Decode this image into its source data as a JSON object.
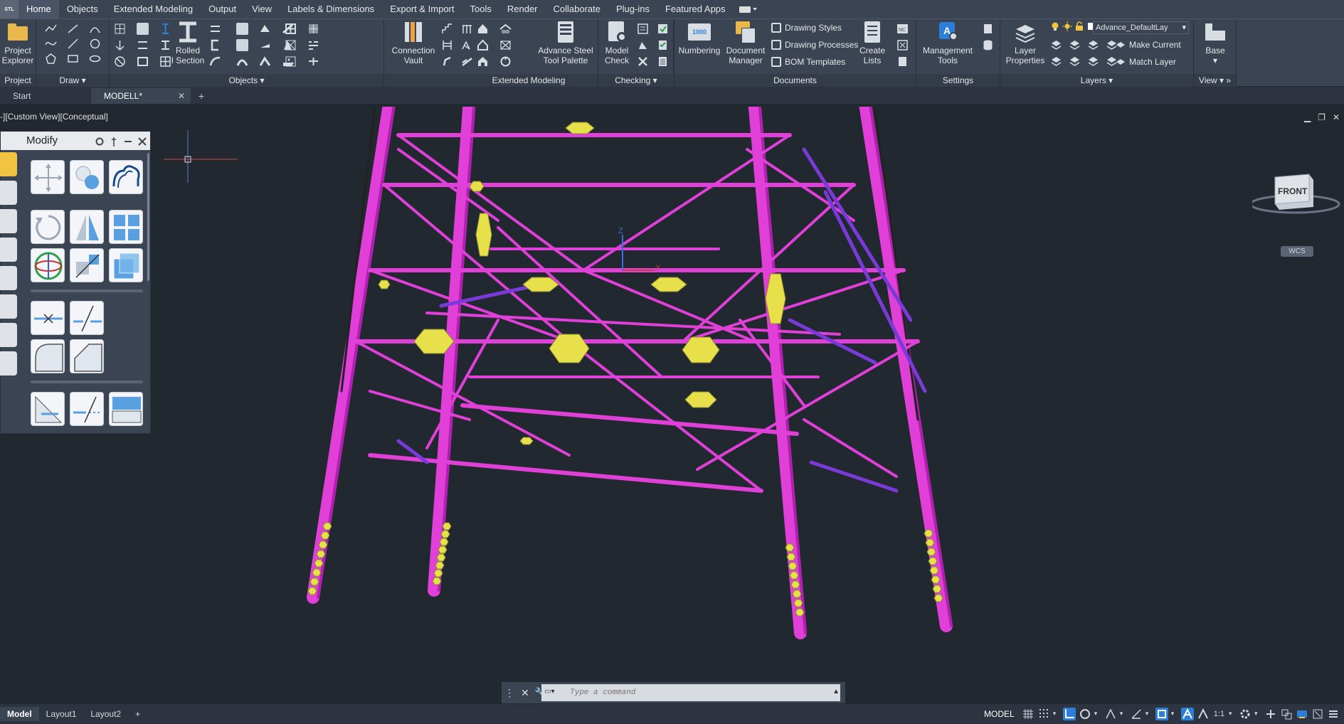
{
  "menu": {
    "logo_text": "STL",
    "tabs": [
      "Home",
      "Objects",
      "Extended Modeling",
      "Output",
      "View",
      "Labels & Dimensions",
      "Export & Import",
      "Tools",
      "Render",
      "Collaborate",
      "Plug-ins",
      "Featured Apps"
    ]
  },
  "ribbon": {
    "project": {
      "btn_line1": "Project",
      "btn_line2": "Explorer",
      "title": "Project"
    },
    "draw": {
      "title": "Draw"
    },
    "objects": {
      "rolled_line1": "Rolled",
      "rolled_line2": "I Section",
      "title": "Objects"
    },
    "ext": {
      "conn_line1": "Connection",
      "conn_line2": "Vault",
      "tool_line1": "Advance Steel",
      "tool_line2": "Tool Palette",
      "title": "Extended Modeling"
    },
    "checking": {
      "mc_line1": "Model",
      "mc_line2": "Check",
      "title": "Checking"
    },
    "documents": {
      "numbering": "Numbering",
      "dm_line1": "Document",
      "dm_line2": "Manager",
      "drawing_styles": "Drawing Styles",
      "drawing_processes": "Drawing Processes",
      "bom_templates": "BOM Templates",
      "cl_line1": "Create",
      "cl_line2": "Lists",
      "title": "Documents",
      "numbering_badge": "1000"
    },
    "settings": {
      "mt_line1": "Management",
      "mt_line2": "Tools",
      "title": "Settings"
    },
    "layers": {
      "lp_line1": "Layer",
      "lp_line2": "Properties",
      "layer_name": "Advance_DefaultLay",
      "make_current": "Make Current",
      "match_layer": "Match Layer",
      "title": "Layers"
    },
    "view": {
      "base": "Base",
      "title": "View"
    }
  },
  "doctabs": {
    "start": "Start",
    "model": "MODELL*"
  },
  "viewport": {
    "label": "-][Custom View][Conceptual]",
    "cube_face": "FRONT",
    "wcs": "WCS"
  },
  "modify": {
    "title": "Modify"
  },
  "command": {
    "placeholder": "Type a command"
  },
  "status": {
    "tabs": [
      "Model",
      "Layout1",
      "Layout2"
    ],
    "model_label": "MODEL",
    "scale": "1:1"
  },
  "colors": {
    "beam": "#e040d8",
    "beam_dark": "#b01fb0",
    "brace": "#7a3ad8",
    "plate": "#e8e04a",
    "bg": "#212830",
    "ribbon": "#3b4453"
  }
}
